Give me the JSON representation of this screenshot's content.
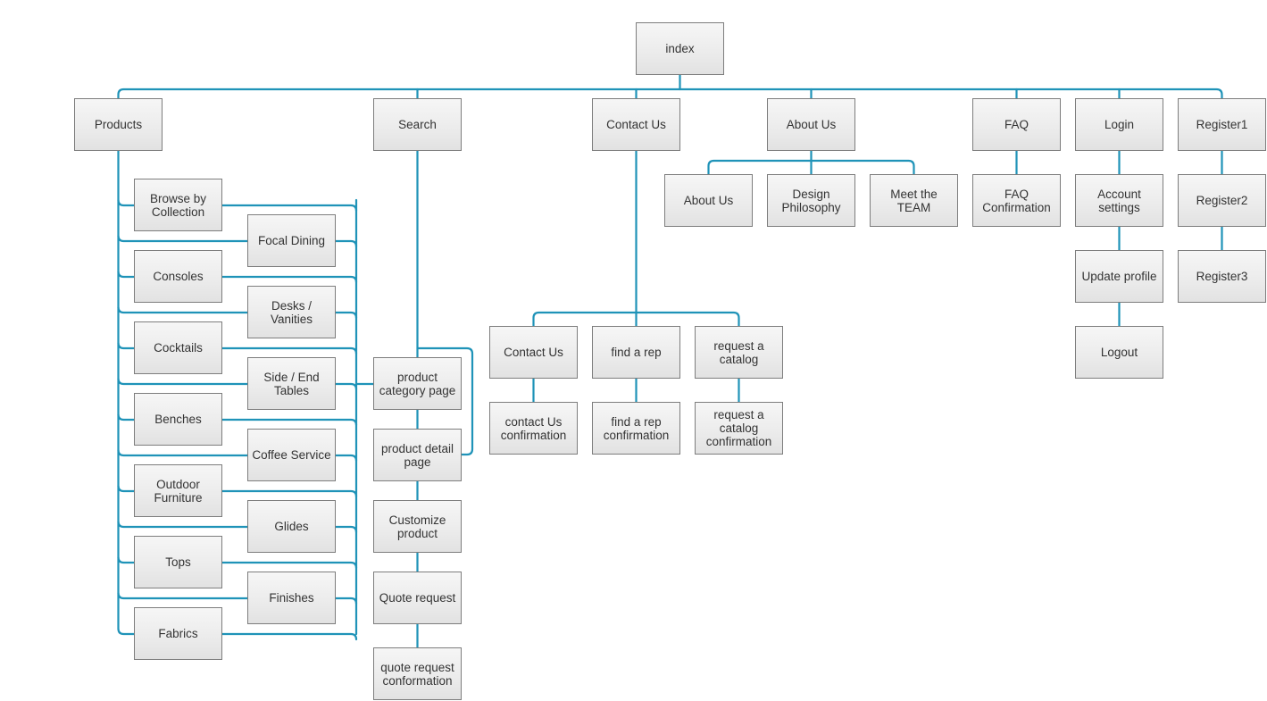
{
  "diagram": {
    "type": "sitemap",
    "colors": {
      "connector": "#1f93b8",
      "node_border": "#7d7d7d",
      "node_fill": "#ececec",
      "text": "#333333"
    },
    "root": {
      "id": "index",
      "label": "index"
    },
    "sections": [
      {
        "id": "products",
        "label": "Products",
        "children_left": [
          {
            "id": "browse-by-collection",
            "label": "Browse by\nCollection"
          },
          {
            "id": "consoles",
            "label": "Consoles"
          },
          {
            "id": "cocktails",
            "label": "Cocktails"
          },
          {
            "id": "benches",
            "label": "Benches"
          },
          {
            "id": "outdoor-furniture",
            "label": "Outdoor\nFurniture"
          },
          {
            "id": "tops",
            "label": "Tops"
          },
          {
            "id": "fabrics",
            "label": "Fabrics"
          }
        ],
        "children_right": [
          {
            "id": "focal-dining",
            "label": "Focal Dining"
          },
          {
            "id": "desks-vanities",
            "label": "Desks / Vanities"
          },
          {
            "id": "side-end-tables",
            "label": "Side / End\nTables"
          },
          {
            "id": "coffee-service",
            "label": "Coffee Service"
          },
          {
            "id": "glides",
            "label": "Glides"
          },
          {
            "id": "finishes",
            "label": "Finishes"
          }
        ],
        "flow": [
          {
            "id": "product-category-page",
            "label": "product\ncategory page"
          },
          {
            "id": "product-detail-page",
            "label": "product detail\npage"
          },
          {
            "id": "customize-product",
            "label": "Customize\nproduct"
          },
          {
            "id": "quote-request",
            "label": "Quote request"
          },
          {
            "id": "quote-request-conformation",
            "label": "quote request\nconformation"
          }
        ]
      },
      {
        "id": "search",
        "label": "Search"
      },
      {
        "id": "contact-us",
        "label": "Contact Us",
        "children": [
          {
            "id": "contact-us-page",
            "label": "Contact Us",
            "confirm": {
              "id": "contact-us-confirmation",
              "label": "contact Us\nconfirmation"
            }
          },
          {
            "id": "find-a-rep",
            "label": "find a rep",
            "confirm": {
              "id": "find-a-rep-confirmation",
              "label": "find a rep\nconfirmation"
            }
          },
          {
            "id": "request-a-catalog",
            "label": "request a\ncatalog",
            "confirm": {
              "id": "request-a-catalog-confirmation",
              "label": "request a\ncatalog\nconfirmation"
            }
          }
        ]
      },
      {
        "id": "about-us",
        "label": "About Us",
        "children": [
          {
            "id": "about-us-page",
            "label": "About Us"
          },
          {
            "id": "design-philosophy",
            "label": "Design\nPhilosophy"
          },
          {
            "id": "meet-the-team",
            "label": "Meet the TEAM"
          }
        ]
      },
      {
        "id": "faq",
        "label": "FAQ",
        "chain": [
          {
            "id": "faq-confirmation",
            "label": "FAQ\nConfirmation"
          }
        ]
      },
      {
        "id": "login",
        "label": "Login",
        "chain": [
          {
            "id": "account-settings",
            "label": "Account\nsettings"
          },
          {
            "id": "update-profile",
            "label": "Update profile"
          },
          {
            "id": "logout",
            "label": "Logout"
          }
        ]
      },
      {
        "id": "register1",
        "label": "Register1",
        "chain": [
          {
            "id": "register2",
            "label": "Register2"
          },
          {
            "id": "register3",
            "label": "Register3"
          }
        ]
      }
    ]
  }
}
